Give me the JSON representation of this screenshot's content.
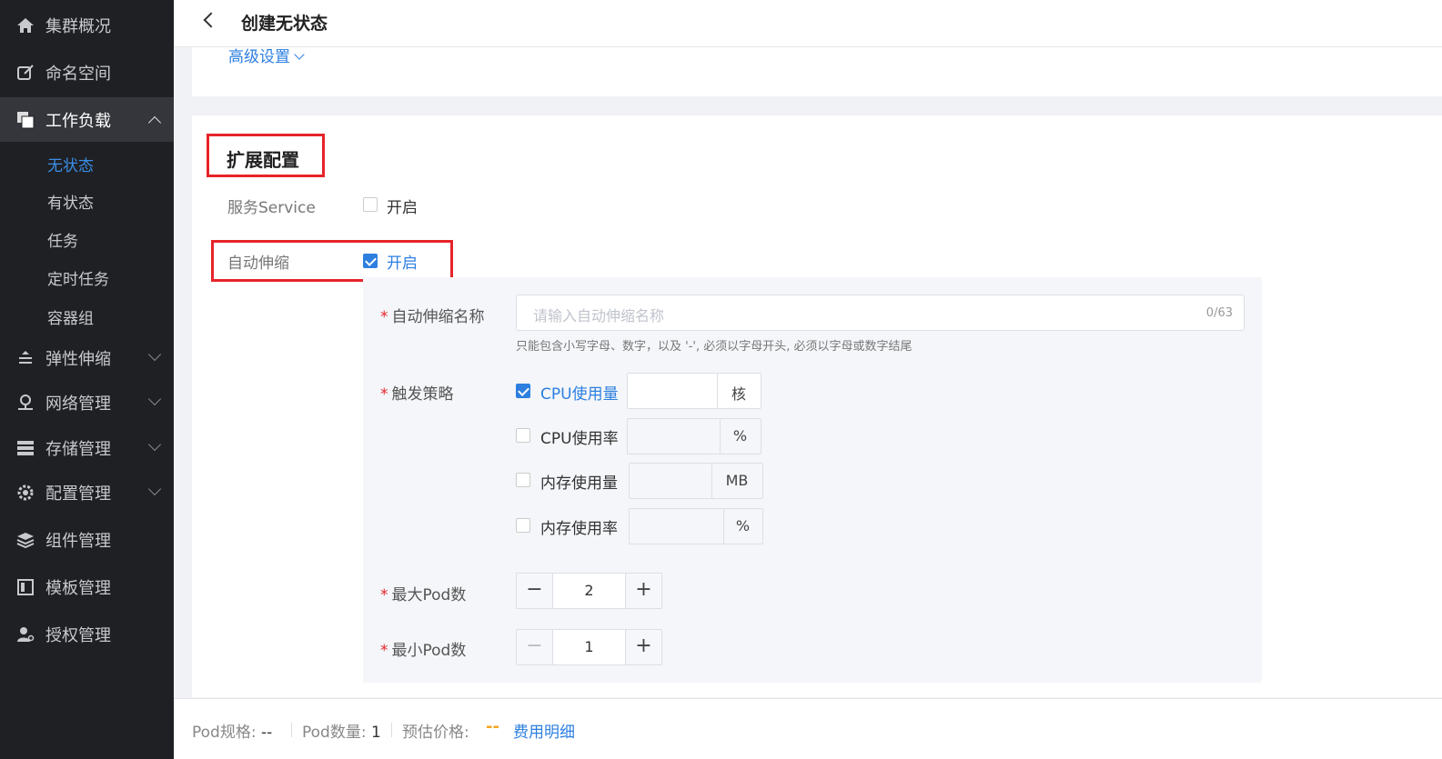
{
  "sidebar": {
    "items": [
      {
        "label": "集群概况",
        "icon": "home-icon"
      },
      {
        "label": "命名空间",
        "icon": "edit-icon"
      },
      {
        "label": "工作负载",
        "icon": "copy-icon"
      },
      {
        "label": "弹性伸缩",
        "icon": "scale-icon"
      },
      {
        "label": "网络管理",
        "icon": "network-icon"
      },
      {
        "label": "存储管理",
        "icon": "storage-icon"
      },
      {
        "label": "配置管理",
        "icon": "gear-icon"
      },
      {
        "label": "组件管理",
        "icon": "layers-icon"
      },
      {
        "label": "模板管理",
        "icon": "template-icon"
      },
      {
        "label": "授权管理",
        "icon": "user-key-icon"
      }
    ],
    "sub_items": [
      "无状态",
      "有状态",
      "任务",
      "定时任务",
      "容器组"
    ]
  },
  "header": {
    "title": "创建无状态"
  },
  "advanced": {
    "label": "高级设置"
  },
  "section": {
    "title": "扩展配置",
    "service_label": "服务Service",
    "service_toggle": "开启",
    "autoscale_label": "自动伸缩",
    "autoscale_toggle": "开启"
  },
  "form": {
    "name_label": "自动伸缩名称",
    "name_placeholder": "请输入自动伸缩名称",
    "name_count": "0/63",
    "name_hint": "只能包含小写字母、数字，以及 '-', 必须以字母开头, 必须以字母或数字结尾",
    "trigger_label": "触发策略",
    "triggers": [
      {
        "label": "CPU使用量",
        "unit": "核",
        "checked": true
      },
      {
        "label": "CPU使用率",
        "unit": "%",
        "checked": false
      },
      {
        "label": "内存使用量",
        "unit": "MB",
        "checked": false
      },
      {
        "label": "内存使用率",
        "unit": "%",
        "checked": false
      }
    ],
    "max_pod_label": "最大Pod数",
    "max_pod_value": "2",
    "min_pod_label": "最小Pod数",
    "min_pod_value": "1",
    "minus": "−",
    "plus": "+"
  },
  "footer": {
    "spec_label": "Pod规格:",
    "spec_value": "--",
    "count_label": "Pod数量:",
    "count_value": "1",
    "price_label": "预估价格:",
    "price_value": "--",
    "detail_link": "费用明细"
  },
  "colors": {
    "accent": "#2d7fe0",
    "highlight": "#e6242a",
    "sidebar_bg": "#1f2024"
  }
}
